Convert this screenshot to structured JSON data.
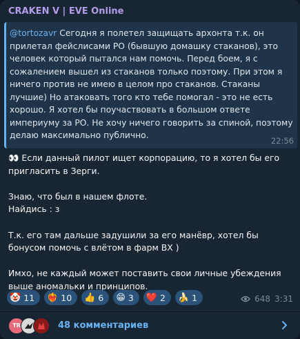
{
  "post": {
    "channel_name": "CRAKEN V | EVE Online",
    "quote": {
      "mention": "@tortozavr",
      "text": " Сегодня я полетел защищать архонта т.к. он прилетал фейслисами РО (бывшую домашку стаканов), это человек который пытался нам помочь. Перед боем, я с сожалением вышел из стаканов только поэтому. При этом я ничего против не имею в целом про стаканов. Стаканы лучшие) Но атаковать того кто тебе помогал - это не есть хорошо. Я хотел бы поучаствовать в большом ответе империуму за РО. Не хочу ничего говорить за спиной, поэтому делаю максимально публично.",
      "time": "22:56"
    },
    "body": "👀 Если данный пилот ищет корпорацию, то я хотел бы его пригласить в Зерги.\n\nЗнаю, что был в нашем флоте.\nНайдись : з\n\nТ.к. его там дальше задушили за его манёвр, хотел бы бонусом помочь с влётом в фарм ВХ )\n\nИмхо, не каждый может поставить свои личные убеждения выше аномальки и принципов.",
    "reactions": [
      {
        "emoji": "🤡",
        "count": "11",
        "icon": "clown-face-icon"
      },
      {
        "emoji": "❤️‍🔥",
        "count": "10",
        "icon": "heart-on-fire-icon"
      },
      {
        "emoji": "👍",
        "count": "6",
        "icon": "thumbs-up-icon"
      },
      {
        "emoji": "😁",
        "count": "3",
        "icon": "grinning-face-icon"
      },
      {
        "emoji": "❤️",
        "count": "2",
        "icon": "red-heart-icon"
      },
      {
        "emoji": "🍌",
        "count": "1",
        "icon": "banana-icon"
      }
    ],
    "views": "648",
    "time": "3:31",
    "comments": {
      "label": "48 комментариев",
      "avatars": [
        "TR",
        "",
        ""
      ]
    }
  },
  "colors": {
    "background": "#182533",
    "accent": "#6ab3f3",
    "channel_name": "#b39ce8",
    "reaction_bg": "#2b5278"
  }
}
